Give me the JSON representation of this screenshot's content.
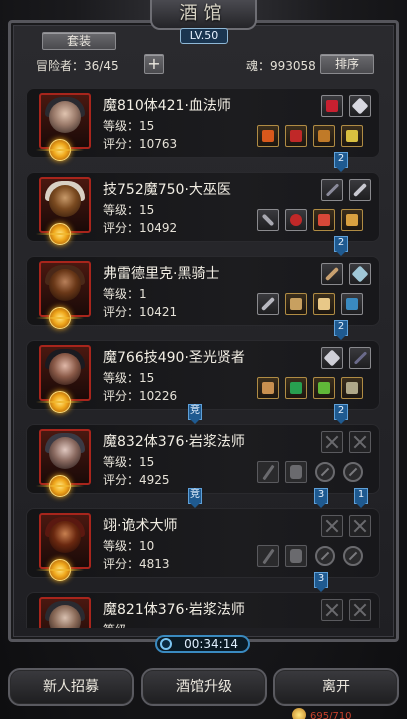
{
  "header": {
    "title": "酒馆",
    "level": "LV.50",
    "set_label": "套装",
    "adventurers": "冒险者：36/45",
    "add_symbol": "+",
    "soul": "魂：993058",
    "sort_label": "排序"
  },
  "heroes": [
    {
      "name": "魔810体421·血法师",
      "level": "等级：15",
      "score": "评分：10763"
    },
    {
      "name": "技752魔750·大巫医",
      "level": "等级：15",
      "score": "评分：10492"
    },
    {
      "name": "弗雷德里克·黑骑士",
      "level": "等级：1",
      "score": "评分：10421"
    },
    {
      "name": "魔766技490·圣光贤者",
      "level": "等级：15",
      "score": "评分：10226"
    },
    {
      "name": "魔832体376·岩浆法师",
      "level": "等级：15",
      "score": "评分：4925"
    },
    {
      "name": "翊·诡术大师",
      "level": "等级：10",
      "score": "评分：4813"
    },
    {
      "name": "魔821体376·岩浆法师",
      "level": "等级",
      "score": ""
    }
  ],
  "connectors": {
    "c1": "2",
    "c2": "2",
    "c3": "2",
    "c4a": "竞",
    "c4b": "2",
    "c5a": "竞",
    "c5b": "3",
    "c5c": "1",
    "c6": "3"
  },
  "timer": "00:34:14",
  "bottom": {
    "recruit": "新人招募",
    "upgrade": "酒馆升级",
    "leave": "离开"
  },
  "cutoff": "695/710",
  "colors": {
    "accent_blue": "#1f5a90",
    "portrait_border": "#a8251c",
    "gold": "#f0a81c"
  }
}
